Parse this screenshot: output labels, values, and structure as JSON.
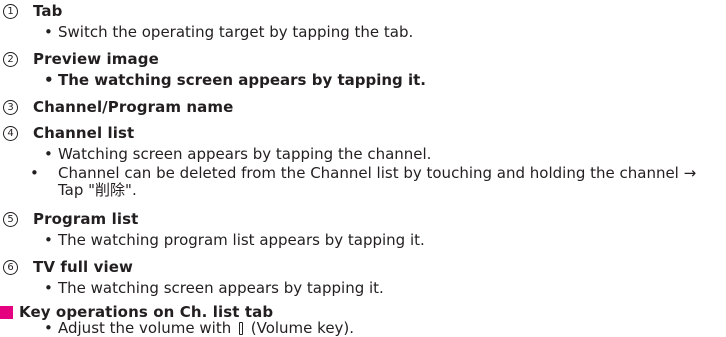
{
  "items": [
    {
      "num": "1",
      "title": "Tab",
      "bullets": [
        "Switch the operating target by tapping the tab."
      ]
    },
    {
      "num": "2",
      "title": "Preview image",
      "bullets": [
        "The watching screen appears by tapping it."
      ]
    },
    {
      "num": "3",
      "title": "Channel/Program name",
      "bullets": []
    },
    {
      "num": "4",
      "title": "Channel list",
      "bullets": [
        "Watching screen appears by tapping the channel.",
        "Channel can be deleted from the Channel list by touching and holding the channel → Tap \"削除\"."
      ]
    },
    {
      "num": "5",
      "title": "Program list",
      "bullets": [
        "The watching program list appears by tapping it."
      ]
    },
    {
      "num": "6",
      "title": "TV full view",
      "bullets": [
        "The watching screen appears by tapping it."
      ]
    }
  ],
  "key_section": {
    "heading": "Key operations on Ch. list tab",
    "accent_color": "#e4007f",
    "bullet_before": "Adjust the volume with ",
    "icon": "volume-key-icon",
    "bullet_after": " (Volume key)."
  },
  "bullet_glyph": "•"
}
